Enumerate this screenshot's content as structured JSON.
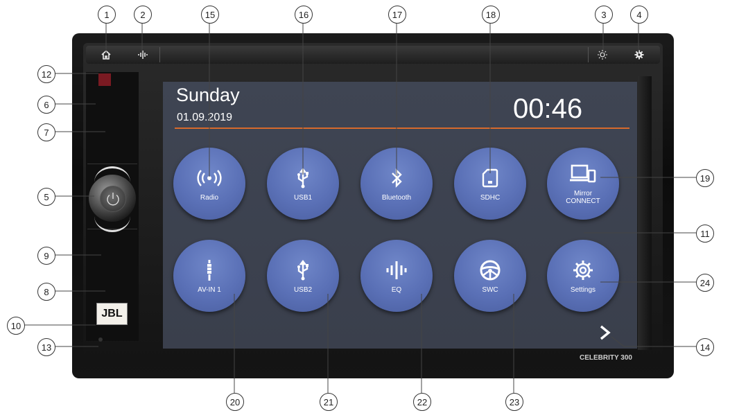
{
  "status": {
    "day": "Sunday",
    "date": "01.09.2019",
    "time": "00:46"
  },
  "top_bar": {
    "home_icon": "home-icon",
    "audio_icon": "audio-wave-icon",
    "brightness_icon": "sun-icon",
    "settings_icon": "gear-icon"
  },
  "tiles": [
    {
      "label": "Radio",
      "icon": "broadcast-icon"
    },
    {
      "label": "USB1",
      "icon": "usb-icon"
    },
    {
      "label": "Bluetooth",
      "icon": "bluetooth-icon"
    },
    {
      "label": "SDHC",
      "icon": "sd-card-icon"
    },
    {
      "label": "Mirror CONNECT",
      "icon": "devices-icon"
    },
    {
      "label": "AV-IN 1",
      "icon": "audio-jack-icon"
    },
    {
      "label": "USB2",
      "icon": "usb-icon"
    },
    {
      "label": "EQ",
      "icon": "equalizer-icon"
    },
    {
      "label": "SWC",
      "icon": "steering-wheel-icon"
    },
    {
      "label": "Settings",
      "icon": "gear-icon"
    }
  ],
  "branding": {
    "jbl": "JBL",
    "model": "CELEBRITY 300"
  },
  "callouts": [
    "1",
    "2",
    "3",
    "4",
    "5",
    "6",
    "7",
    "8",
    "9",
    "10",
    "11",
    "12",
    "13",
    "14",
    "15",
    "16",
    "17",
    "18",
    "19",
    "20",
    "21",
    "22",
    "23",
    "24"
  ],
  "colors": {
    "screen_bg": "#3d4250",
    "tile": "#5a70b6",
    "divider": "#d86a2c"
  }
}
